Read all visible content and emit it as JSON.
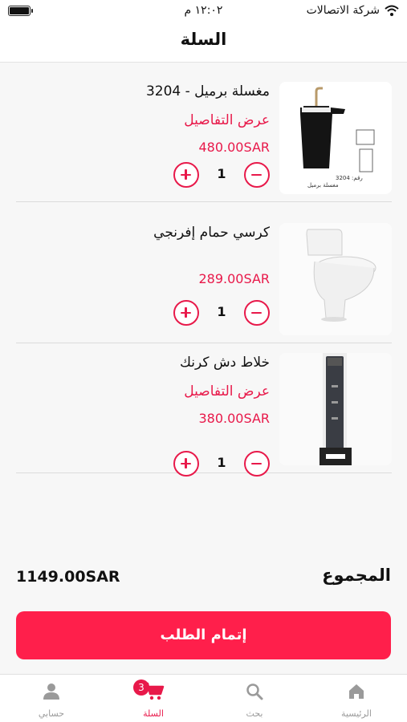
{
  "status_bar": {
    "carrier": "شركة الاتصالات",
    "time": "١٢:٠٢ م"
  },
  "header": {
    "title": "السلة"
  },
  "cart": {
    "items": [
      {
        "name": "مغسلة برميل - 3204",
        "details_link": "عرض التفاصيل",
        "price": "480.00SAR",
        "quantity": "1",
        "image_caption": "رقم: 3204 مغسلة برميل"
      },
      {
        "name": "كرسي حمام إفرنجي",
        "details_link": "",
        "price": "289.00SAR",
        "quantity": "1"
      },
      {
        "name": "خلاط دش كرنك",
        "details_link": "عرض التفاصيل",
        "price": "380.00SAR",
        "quantity": "1"
      }
    ]
  },
  "summary": {
    "total_label": "المجموع",
    "total_value": "1149.00SAR"
  },
  "checkout": {
    "label": "إتمام الطلب"
  },
  "tabs": [
    {
      "label": "الرئيسية",
      "icon": "home-icon"
    },
    {
      "label": "بحث",
      "icon": "search-icon"
    },
    {
      "label": "السلة",
      "icon": "cart-icon",
      "badge": "3",
      "active": true
    },
    {
      "label": "حسابي",
      "icon": "person-icon"
    }
  ],
  "colors": {
    "accent": "#e8194a",
    "button": "#ff1f4b",
    "tab_inactive": "#9a9a9a",
    "background": "#f7f7f7"
  }
}
